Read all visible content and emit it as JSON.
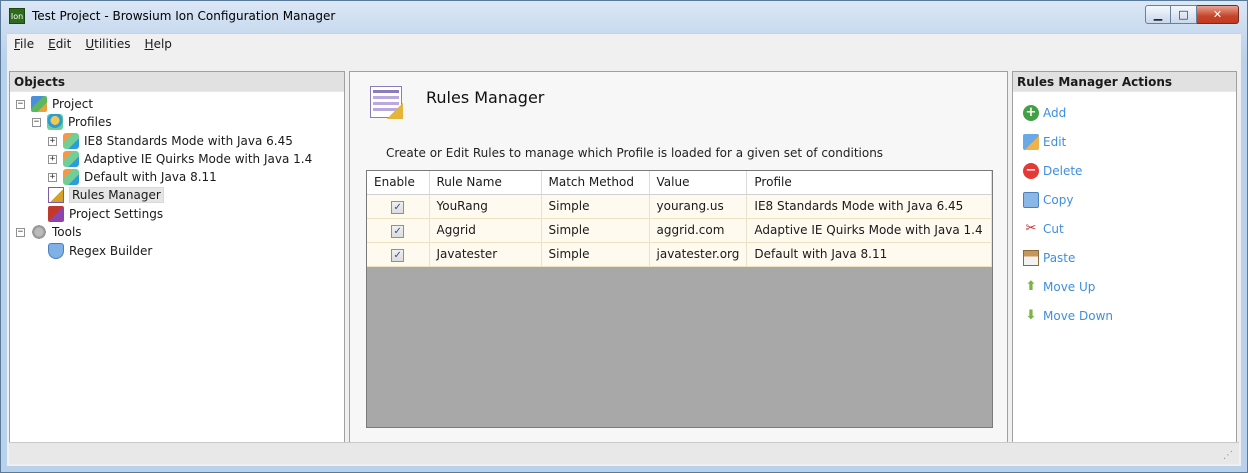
{
  "window": {
    "title": "Test Project - Browsium Ion Configuration Manager",
    "app_icon_text": "Ion"
  },
  "menu": [
    {
      "label": "File",
      "mnemonic": "F",
      "rest": "ile"
    },
    {
      "label": "Edit",
      "mnemonic": "E",
      "rest": "dit"
    },
    {
      "label": "Utilities",
      "mnemonic": "U",
      "rest": "tilities"
    },
    {
      "label": "Help",
      "mnemonic": "H",
      "rest": "elp"
    }
  ],
  "objects_panel": {
    "header": "Objects",
    "tree": {
      "project": "Project",
      "profiles": "Profiles",
      "profile_items": [
        "IE8 Standards Mode with Java 6.45",
        "Adaptive IE Quirks Mode with Java 1.4",
        "Default with Java 8.11"
      ],
      "rules_manager": "Rules Manager",
      "project_settings": "Project Settings",
      "tools": "Tools",
      "regex_builder": "Regex Builder",
      "selected": "Rules Manager"
    }
  },
  "rules_manager": {
    "title": "Rules Manager",
    "description": "Create or Edit Rules to manage which Profile is loaded for a given set of conditions",
    "columns": [
      "Enable",
      "Rule Name",
      "Match Method",
      "Value",
      "Profile"
    ],
    "rows": [
      {
        "enabled": true,
        "rule_name": "YouRang",
        "match_method": "Simple",
        "value": "yourang.us",
        "profile": "IE8 Standards Mode with Java 6.45"
      },
      {
        "enabled": true,
        "rule_name": "Aggrid",
        "match_method": "Simple",
        "value": "aggrid.com",
        "profile": "Adaptive IE Quirks Mode with Java 1.4"
      },
      {
        "enabled": true,
        "rule_name": "Javatester",
        "match_method": "Simple",
        "value": "javatester.org",
        "profile": "Default with Java 8.11"
      }
    ]
  },
  "actions_panel": {
    "header": "Rules Manager Actions",
    "items": [
      {
        "label": "Add",
        "icon": "add-icon"
      },
      {
        "label": "Edit",
        "icon": "edit-icon"
      },
      {
        "label": "Delete",
        "icon": "delete-icon"
      },
      {
        "label": "Copy",
        "icon": "copy-icon"
      },
      {
        "label": "Cut",
        "icon": "cut-icon"
      },
      {
        "label": "Paste",
        "icon": "paste-icon"
      },
      {
        "label": "Move Up",
        "icon": "move-up-icon"
      },
      {
        "label": "Move Down",
        "icon": "move-down-icon"
      }
    ]
  },
  "colors": {
    "action_link": "#3d8fde",
    "row_background": "#fffaf0",
    "grid_empty_area": "#a8a8a8"
  }
}
